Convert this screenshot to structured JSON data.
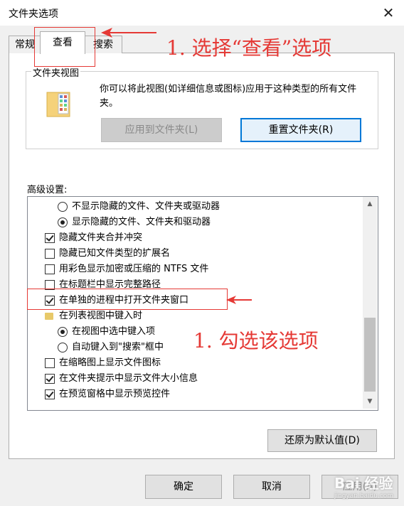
{
  "window": {
    "title": "文件夹选项",
    "close_label": "✕"
  },
  "tabs": [
    {
      "label": "常规"
    },
    {
      "label": "查看",
      "selected": true
    },
    {
      "label": "搜索"
    }
  ],
  "folder_views": {
    "legend": "文件夹视图",
    "description": "你可以将此视图(如详细信息或图标)应用于这种类型的所有文件夹。",
    "apply_button": "应用到文件夹(L)",
    "reset_button": "重置文件夹(R)"
  },
  "advanced": {
    "label": "高级设置:",
    "items": [
      {
        "type": "radio",
        "checked": false,
        "indent": 2,
        "label": "不显示隐藏的文件、文件夹或驱动器"
      },
      {
        "type": "radio",
        "checked": true,
        "indent": 2,
        "label": "显示隐藏的文件、文件夹和驱动器"
      },
      {
        "type": "checkbox",
        "checked": true,
        "indent": 1,
        "label": "隐藏文件夹合并冲突"
      },
      {
        "type": "checkbox",
        "checked": false,
        "indent": 1,
        "label": "隐藏已知文件类型的扩展名"
      },
      {
        "type": "checkbox",
        "checked": false,
        "indent": 1,
        "label": "用彩色显示加密或压缩的 NTFS 文件"
      },
      {
        "type": "checkbox",
        "checked": false,
        "indent": 1,
        "label": "在标题栏中显示完整路径"
      },
      {
        "type": "checkbox",
        "checked": true,
        "indent": 1,
        "label": "在单独的进程中打开文件夹窗口"
      },
      {
        "type": "folder",
        "checked": false,
        "indent": 1,
        "label": "在列表视图中键入时"
      },
      {
        "type": "radio",
        "checked": true,
        "indent": 2,
        "label": "在视图中选中键入项"
      },
      {
        "type": "radio",
        "checked": false,
        "indent": 2,
        "label": "自动键入到\"搜索\"框中"
      },
      {
        "type": "checkbox",
        "checked": false,
        "indent": 1,
        "label": "在缩略图上显示文件图标"
      },
      {
        "type": "checkbox",
        "checked": true,
        "indent": 1,
        "label": "在文件夹提示中显示文件大小信息"
      },
      {
        "type": "checkbox",
        "checked": true,
        "indent": 1,
        "label": "在预览窗格中显示预览控件"
      }
    ],
    "restore_button": "还原为默认值(D)"
  },
  "footer": {
    "ok": "确定",
    "cancel": "取消",
    "apply": "应用(A)"
  },
  "annotations": {
    "step1": "1. 选择“查看”选项",
    "step2": "1. 勾选该选项"
  },
  "watermark": {
    "text": "Bai 经验",
    "sub": "jingyan.baidu.com"
  },
  "colors": {
    "annotation": "#e53935",
    "focus_border": "#0078d7"
  }
}
